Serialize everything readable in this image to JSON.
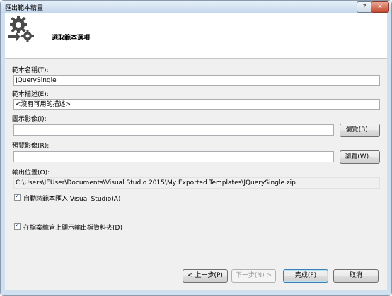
{
  "window": {
    "title": "匯出範本精靈",
    "help_label": "?",
    "close_label": "✕"
  },
  "header": {
    "page_title": "選取範本選項"
  },
  "form": {
    "template_name_label": "範本名稱(T):",
    "template_name_value": "JQuerySingle",
    "template_desc_label": "範本描述(E):",
    "template_desc_value": "<沒有可用的描述>",
    "icon_image_label": "圖示影像(I):",
    "icon_image_value": "",
    "icon_browse_label": "瀏覽(B)...",
    "preview_image_label": "預覽影像(R):",
    "preview_image_value": "",
    "preview_browse_label": "瀏覽(W)...",
    "output_location_label": "輸出位置(O):",
    "output_location_value": "C:\\Users\\IEUser\\Documents\\Visual Studio 2015\\My Exported Templates\\JQuerySingle.zip",
    "auto_import_label": "自動將範本匯入 Visual Studio(A)",
    "auto_import_checked": true,
    "show_folder_label": "在檔案總管上顯示輸出檔資料夾(D)",
    "show_folder_checked": true
  },
  "footer": {
    "prev_label": "< 上一步(P)",
    "next_label": "下一步(N) >",
    "finish_label": "完成(F)",
    "cancel_label": "取消"
  }
}
